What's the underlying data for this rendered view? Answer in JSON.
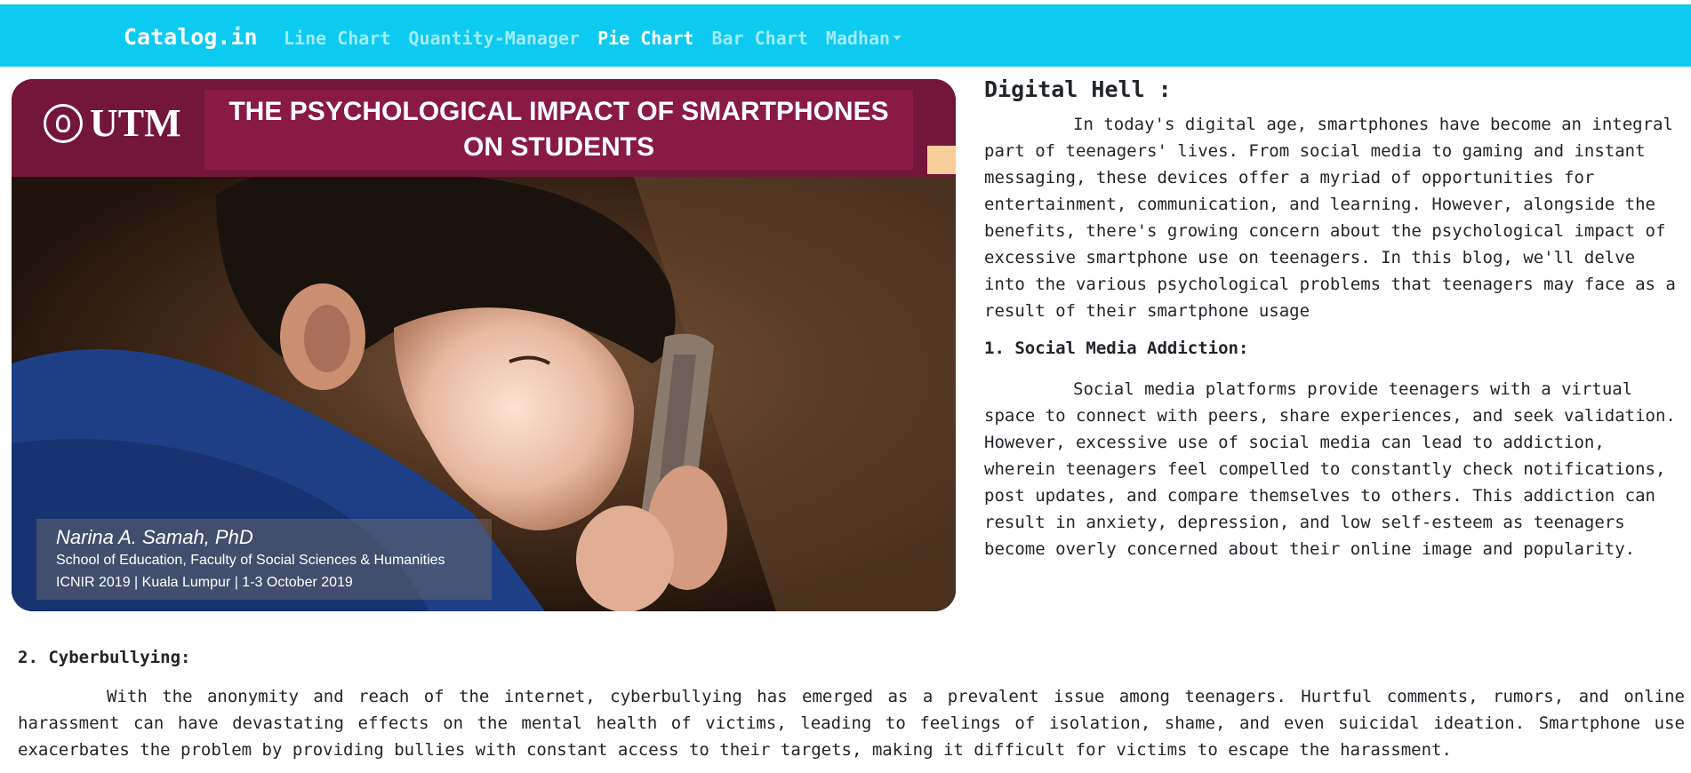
{
  "navbar": {
    "brand": "Catalog.in",
    "links": [
      {
        "label": "Line Chart",
        "active": false
      },
      {
        "label": "Quantity-Manager",
        "active": false
      },
      {
        "label": "Pie Chart",
        "active": true
      },
      {
        "label": "Bar Chart",
        "active": false
      },
      {
        "label": "Madhan",
        "active": false,
        "dropdown": true
      }
    ],
    "background": "#0dcaf0"
  },
  "hero_image": {
    "logo_text": "UTM",
    "title_line1": "THE PSYCHOLOGICAL IMPACT OF SMARTPHONES",
    "title_line2": "ON STUDENTS",
    "author": "Narina A. Samah, PhD",
    "affiliation": "School of Education, Faculty of Social Sciences & Humanities",
    "event": "ICNIR 2019 | Kuala Lumpur | 1-3 October 2019",
    "banner_color": "#74153a"
  },
  "article": {
    "heading": "Digital Hell :",
    "intro": "In today's digital age, smartphones have become an integral part of teenagers' lives. From social media to gaming and instant messaging, these devices offer a myriad of opportunities for entertainment, communication, and learning. However, alongside the benefits, there's growing concern about the psychological impact of excessive smartphone use on teenagers. In this blog, we'll delve into the various psychological problems that teenagers may face as a result of their smartphone usage",
    "section1_heading": "1. Social Media Addiction:",
    "section1_body": "Social media platforms provide teenagers with a virtual space to connect with peers, share experiences, and seek validation. However, excessive use of social media can lead to addiction, wherein teenagers feel compelled to constantly check notifications, post updates, and compare themselves to others. This addiction can result in anxiety, depression, and low self-esteem as teenagers become overly concerned about their online image and popularity.",
    "section2_heading": "2. Cyberbullying:",
    "section2_body": "With the anonymity and reach of the internet, cyberbullying has emerged as a prevalent issue among teenagers. Hurtful comments, rumors, and online harassment can have devastating effects on the mental health of victims, leading to feelings of isolation, shame, and even suicidal ideation. Smartphone use exacerbates the problem by providing bullies with constant access to their targets, making it difficult for victims to escape the harassment."
  }
}
